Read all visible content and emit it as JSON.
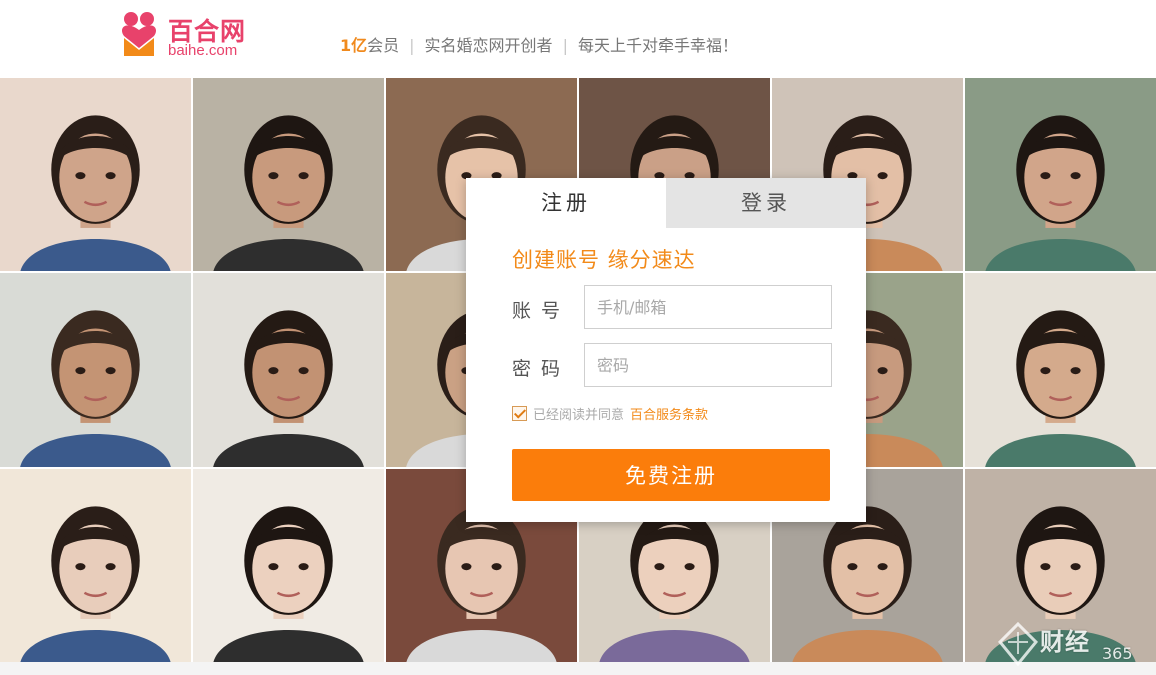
{
  "header": {
    "logo_cn": "百合网",
    "logo_en": "baihe.com",
    "slogan_highlight": "1亿",
    "slogan_part1": "会员",
    "slogan_part2": "实名婚恋网开创者",
    "slogan_part3": "每天上千对牵手幸福！",
    "separator": "|"
  },
  "colors": {
    "brand_pink": "#e8426b",
    "accent_orange": "#f28a19",
    "button_orange": "#fb7d0b"
  },
  "form": {
    "tab_register": "注册",
    "tab_login": "登录",
    "active_tab": "注册",
    "title": "创建账号  缘分速达",
    "account_label": "账  号",
    "account_placeholder": "手机/邮箱",
    "account_value": "",
    "password_label": "密  码",
    "password_placeholder": "密码",
    "password_value": "",
    "agree_checked": true,
    "agree_text": "已经阅读并同意",
    "terms_link": "百合服务条款",
    "submit_label": "免费注册"
  },
  "photo_grid": {
    "rows": 3,
    "cols": 6,
    "tiles": [
      {
        "tone": "#cfa48a",
        "bg": "#e9d8cc"
      },
      {
        "tone": "#c89a7d",
        "bg": "#b9b2a4"
      },
      {
        "tone": "#e6c2a8",
        "bg": "#8c6a52"
      },
      {
        "tone": "#caa087",
        "bg": "#6e5446"
      },
      {
        "tone": "#e3bfa6",
        "bg": "#cfc3b8"
      },
      {
        "tone": "#d1a58a",
        "bg": "#8a9b86"
      },
      {
        "tone": "#c49474",
        "bg": "#d9dbd6"
      },
      {
        "tone": "#c29273",
        "bg": "#e2e0da"
      },
      {
        "tone": "#caa184",
        "bg": "#c7b59b"
      },
      {
        "tone": "#cfa38b",
        "bg": "#7e8f6a"
      },
      {
        "tone": "#c79a7e",
        "bg": "#9aa38a"
      },
      {
        "tone": "#d4aa8c",
        "bg": "#e6e1d8"
      },
      {
        "tone": "#e8cdbb",
        "bg": "#f1e7d9"
      },
      {
        "tone": "#ecd1bf",
        "bg": "#f0ebe4"
      },
      {
        "tone": "#e7c6b2",
        "bg": "#7a4a3c"
      },
      {
        "tone": "#ecd0bd",
        "bg": "#d8d0c4"
      },
      {
        "tone": "#e3c0a7",
        "bg": "#a9a39b"
      },
      {
        "tone": "#e9cdb9",
        "bg": "#bfb2a6"
      }
    ]
  },
  "watermark": {
    "text": "财经",
    "number": "365",
    "icon": "watermark-logo-icon"
  }
}
